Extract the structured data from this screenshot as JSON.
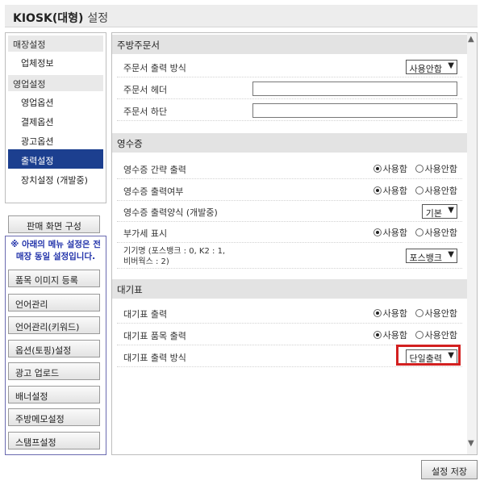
{
  "window": {
    "title": "KIOSK(대형)",
    "subtitle": "설정"
  },
  "sidebar": {
    "groups": [
      {
        "label": "매장설정",
        "items": [
          {
            "label": "업체정보"
          }
        ]
      },
      {
        "label": "영업설정",
        "items": [
          {
            "label": "영업옵션"
          },
          {
            "label": "결제옵션"
          },
          {
            "label": "광고옵션"
          },
          {
            "label": "출력설정",
            "active": true
          },
          {
            "label": "장치설정 (개발중)"
          }
        ]
      }
    ],
    "screen_config_button": "판매 화면 구성",
    "notice": "※ 아래의 메뉴 설정은 전 매장 동일 설정입니다.",
    "menu_buttons": [
      "품목 이미지 등록",
      "언어관리",
      "언어관리(키워드)",
      "옵션(토핑)설정",
      "광고 업로드",
      "배너설정",
      "주방메모설정",
      "스탬프설정"
    ]
  },
  "sections": {
    "kitchen": {
      "title": "주방주문서",
      "print_mode_label": "주문서 출력 방식",
      "print_mode_value": "사용안함",
      "header_label": "주문서 헤더",
      "header_value": "",
      "footer_label": "주문서 하단",
      "footer_value": ""
    },
    "receipt": {
      "title": "영수증",
      "simple_label": "영수증 간략 출력",
      "print_label": "영수증 출력여부",
      "format_label": "영수증 출력양식 (개발중)",
      "format_value": "기본",
      "vat_label": "부가세 표시",
      "device_label_line1": "기기명 (포스뱅크 : 0, K2 : 1,",
      "device_label_line2": "비버웍스 : 2)",
      "device_value": "포스뱅크"
    },
    "waiting": {
      "title": "대기표",
      "print_label": "대기표 출력",
      "item_print_label": "대기표 품목 출력",
      "print_mode_label": "대기표 출력 방식",
      "print_mode_value": "단일출력"
    }
  },
  "radio": {
    "use": "사용함",
    "not_use": "사용안함"
  },
  "footer": {
    "save_button": "설정 저장"
  },
  "colors": {
    "active_item": "#1c3f8f",
    "notice": "#2233aa",
    "highlight": "#d32020"
  }
}
